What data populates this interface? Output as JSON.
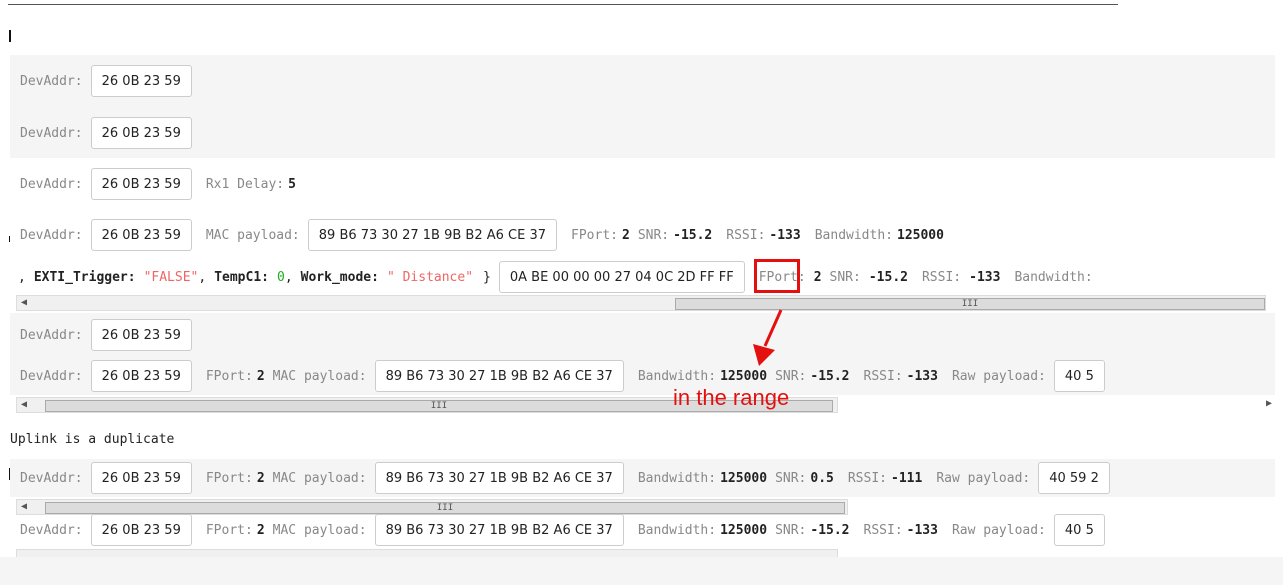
{
  "labels": {
    "devaddr": "DevAddr:",
    "rx1_delay": "Rx1 Delay:",
    "mac_payload": "MAC payload:",
    "fport": "FPort:",
    "snr": "SNR:",
    "rssi": "RSSI:",
    "bandwidth": "Bandwidth:",
    "raw_payload": "Raw payload:"
  },
  "rows": [
    {
      "devaddr": "26 0B 23 59"
    },
    {
      "devaddr": "26 0B 23 59"
    },
    {
      "devaddr": "26 0B 23 59",
      "rx1_delay": "5"
    },
    {
      "devaddr": "26 0B 23 59",
      "mac_payload": "89 B6 73 30 27 1B 9B B2 A6 CE 37",
      "fport": "2",
      "snr": "-15.2",
      "rssi": "-133",
      "bandwidth": "125000"
    },
    {
      "decoded": {
        "lead": ",",
        "key1": "EXTI_Trigger:",
        "val1": "\"FALSE\"",
        "sep1": ",",
        "key2": "TempC1:",
        "val2": "0",
        "sep2": ",",
        "key3": "Work_mode:",
        "val3": "\" Distance\"",
        "close": "}"
      },
      "frm_payload": "0A BE 00 00 00 27 04 0C 2D FF FF",
      "fport": "2",
      "snr": "-15.2",
      "rssi": "-133",
      "bandwidth_label": "Bandwidth:"
    },
    {
      "devaddr": "26 0B 23 59"
    },
    {
      "devaddr": "26 0B 23 59",
      "fport": "2",
      "mac_payload": "89 B6 73 30 27 1B 9B B2 A6 CE 37",
      "bandwidth": "125000",
      "snr": "-15.2",
      "rssi": "-133",
      "raw_payload": "40 5"
    },
    {
      "devaddr": "26 0B 23 59",
      "fport": "2",
      "mac_payload": "89 B6 73 30 27 1B 9B B2 A6 CE 37",
      "bandwidth": "125000",
      "snr": "0.5",
      "rssi": "-111",
      "raw_payload": "40 59 2"
    },
    {
      "devaddr": "26 0B 23 59",
      "fport": "2",
      "mac_payload": "89 B6 73 30 27 1B 9B B2 A6 CE 37",
      "bandwidth": "125000",
      "snr": "-15.2",
      "rssi": "-133",
      "raw_payload": "40 5"
    }
  ],
  "duplicate_notice": "Uplink is a duplicate",
  "annotation": {
    "text": "in the range",
    "color": "#e41010"
  },
  "scrollbar": {
    "grip": "III",
    "left_arrow": "◀",
    "right_arrow": "▶"
  },
  "colors": {
    "string": "#ee6666",
    "number": "#22aa22",
    "label": "#888888",
    "row_alt": "#f5f5f5"
  }
}
